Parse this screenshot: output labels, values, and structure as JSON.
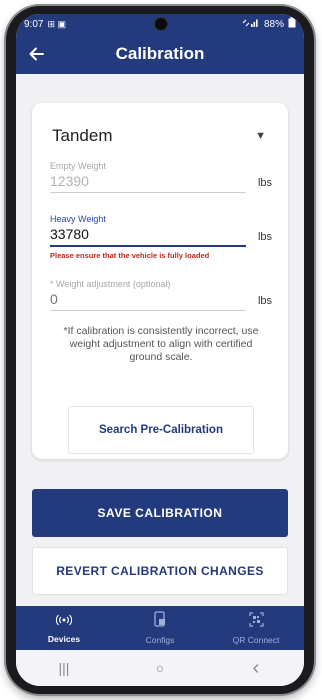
{
  "status": {
    "time": "9:07",
    "left_icons": "⊞ ▣",
    "battery": "88%"
  },
  "appbar": {
    "title": "Calibration"
  },
  "form": {
    "axle_type": "Tandem",
    "empty_weight": {
      "label": "Empty Weight",
      "value": "12390",
      "unit": "lbs"
    },
    "heavy_weight": {
      "label": "Heavy Weight",
      "value": "33780",
      "unit": "lbs",
      "warning": "Please ensure that the vehicle is fully loaded"
    },
    "adjustment": {
      "label": "* Weight adjustment (optional)",
      "placeholder": "0",
      "unit": "lbs"
    },
    "helper_text": "*If calibration is consistently incorrect, use weight adjustment to align with certified ground scale.",
    "precal_button": "Search Pre-Calibration"
  },
  "actions": {
    "save": "SAVE CALIBRATION",
    "revert": "REVERT CALIBRATION CHANGES"
  },
  "bottom_nav": {
    "items": [
      {
        "label": "Devices",
        "icon": "radio-waves-icon",
        "active": true
      },
      {
        "label": "Configs",
        "icon": "phone-config-icon",
        "active": false
      },
      {
        "label": "QR Connect",
        "icon": "qr-code-icon",
        "active": false
      }
    ]
  },
  "system_nav": {
    "recents": "|||",
    "home": "○",
    "back": "‹"
  },
  "colors": {
    "primary": "#233a7d",
    "warning": "#c2271e",
    "background": "#f1f1f3"
  }
}
